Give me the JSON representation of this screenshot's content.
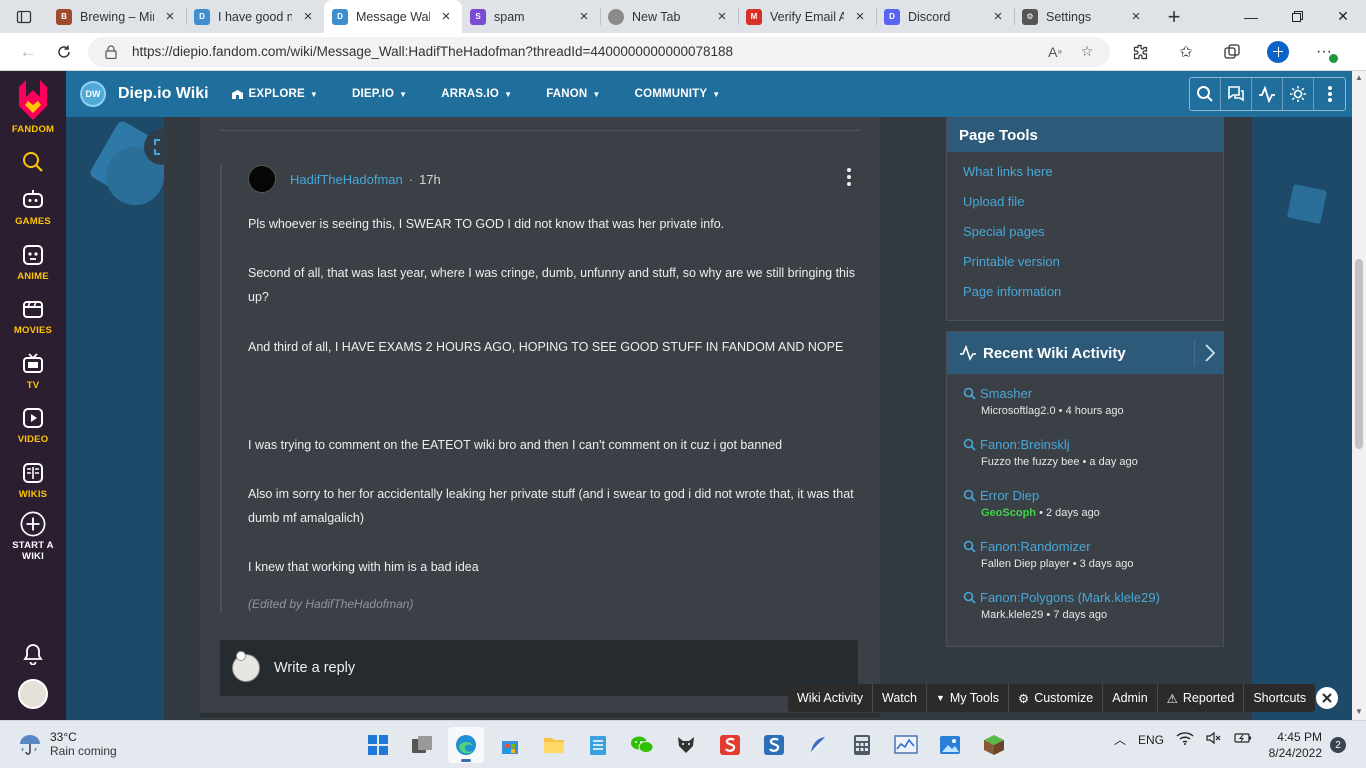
{
  "browser": {
    "tabs": [
      {
        "title": "Brewing – Mir",
        "color": "#a04a2c",
        "glyph": "B",
        "active": false
      },
      {
        "title": "I have good n",
        "color": "#3e8ed0",
        "glyph": "D",
        "active": false
      },
      {
        "title": "Message Wal",
        "color": "#3e8ed0",
        "glyph": "D",
        "active": true
      },
      {
        "title": "spam",
        "color": "#7b4bd6",
        "glyph": "S",
        "active": false
      },
      {
        "title": "New Tab",
        "color": "#8a8a8a",
        "glyph": "",
        "active": false
      },
      {
        "title": "Verify Email A",
        "color": "#d93025",
        "glyph": "M",
        "active": false
      },
      {
        "title": "Discord",
        "color": "#5865f2",
        "glyph": "D",
        "active": false
      },
      {
        "title": "Settings",
        "color": "#555555",
        "glyph": "⚙",
        "active": false
      }
    ],
    "url": "https://diepio.fandom.com/wiki/Message_Wall:HadifTheHadofman?threadId=4400000000000078188"
  },
  "fandom_rail": {
    "brand": "FANDOM",
    "items": [
      "GAMES",
      "ANIME",
      "MOVIES",
      "TV",
      "VIDEO",
      "WIKIS",
      "START A WIKI"
    ]
  },
  "wiki_header": {
    "logo_text": "DW",
    "name": "Diep.io Wiki",
    "nav": [
      "EXPLORE",
      "DIEP.IO",
      "ARRAS.IO",
      "FANON",
      "COMMUNITY"
    ]
  },
  "post": {
    "author": "HadifTheHadofman",
    "separator": "·",
    "time": "17h",
    "paragraphs": [
      "Pls whoever is seeing this, I SWEAR TO GOD I did not know that was her private info.",
      "Second of all, that was last year, where I was cringe, dumb, unfunny and stuff, so why are we still bringing this up?",
      "And third of all, I HAVE EXAMS 2 HOURS AGO, HOPING TO SEE GOOD STUFF IN FANDOM AND NOPE",
      "I was trying to comment on the EATEOT wiki bro and then I can't comment on it cuz i got banned",
      "Also im sorry to her for accidentally leaking her private stuff (and i swear to god i did not wrote that, it was that dumb mf amalgalich)",
      "I knew that working with him is a bad idea"
    ],
    "edited": "(Edited by HadifTheHadofman)"
  },
  "reply": {
    "placeholder": "Write a reply"
  },
  "page_tools": {
    "title": "Page Tools",
    "links": [
      "What links here",
      "Upload file",
      "Special pages",
      "Printable version",
      "Page information"
    ]
  },
  "recent_activity": {
    "title": "Recent Wiki Activity",
    "items": [
      {
        "page": "Smasher",
        "user": "Microsoftlag2.0",
        "when": "• 4 hours ago",
        "highlight": false
      },
      {
        "page": "Fanon:Breinsklj",
        "user": "Fuzzo the fuzzy bee",
        "when": "• a day ago",
        "highlight": false
      },
      {
        "page": "Error Diep",
        "user": "GeoScoph",
        "when": "• 2 days ago",
        "highlight": true
      },
      {
        "page": "Fanon:Randomizer",
        "user": "Fallen Diep player",
        "when": "• 3 days ago",
        "highlight": false
      },
      {
        "page": "Fanon:Polygons (Mark.klele29)",
        "user": "Mark.klele29",
        "when": "• 7 days ago",
        "highlight": false
      }
    ]
  },
  "toolbar": {
    "items": [
      "Wiki Activity",
      "Watch",
      "My Tools",
      "Customize",
      "Admin",
      "Reported",
      "Shortcuts"
    ]
  },
  "taskbar": {
    "temp": "33°C",
    "weather": "Rain coming",
    "lang": "ENG",
    "time": "4:45 PM",
    "date": "8/24/2022",
    "notifications": "2"
  }
}
